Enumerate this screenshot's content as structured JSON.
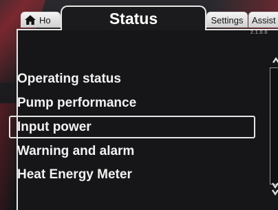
{
  "tabs": {
    "home_label": "Ho",
    "active_label": "Status",
    "settings_label": "Settings",
    "assist_label": "Assist"
  },
  "version": "2.1.0.0",
  "menu": {
    "items": [
      {
        "label": "Operating status"
      },
      {
        "label": "Pump performance"
      },
      {
        "label": "Input power",
        "selected": true
      },
      {
        "label": "Warning and alarm"
      },
      {
        "label": "Heat Energy Meter"
      }
    ]
  },
  "icons": {
    "home": "home-icon",
    "scroll_up": "chevron-up-icon",
    "scroll_down": "chevron-down-icon"
  },
  "colors": {
    "background": "#161618",
    "text": "#f2f2f2",
    "tab_inactive": "#dcdcdc",
    "border": "#e8e8e8"
  }
}
